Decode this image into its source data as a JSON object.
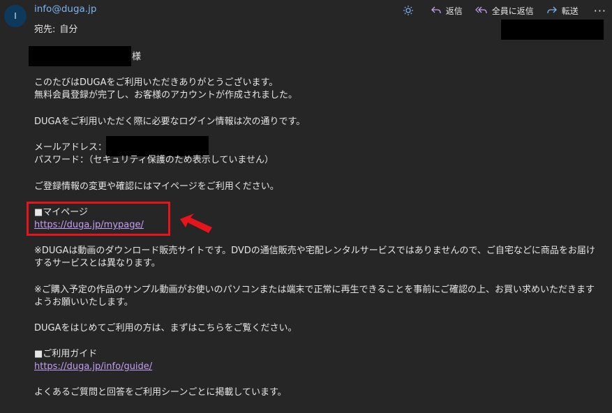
{
  "header": {
    "avatar_initial": "I",
    "sender": "info@duga.jp",
    "to_label": "宛先:",
    "to_value": "自分"
  },
  "toolbar": {
    "reply_label": "返信",
    "reply_all_label": "全員に返信",
    "forward_label": "転送",
    "more_label": "···"
  },
  "email": {
    "salutation_suffix": "様",
    "line_thanks": "このたびはDUGAをご利用いただきありがとうございます。",
    "line_registered": "無料会員登録が完了し、お客様のアカウントが作成されました。",
    "line_login_info": "DUGAをご利用いただく際に必要なログイン情報は次の通りです。",
    "email_label": "メールアドレス：",
    "password_line": "パスワード：（セキュリティ保護のため表示していません）",
    "line_mypage_info": "ご登録情報の変更や確認にはマイページをご利用ください。",
    "mypage_heading": "■マイページ",
    "mypage_url": "https://duga.jp/mypage/",
    "note_download": "※DUGAは動画のダウンロード販売サイトです。DVDの通信販売や宅配レンタルサービスではありませんので、ご自宅などに商品をお届けするサービスとは異なります。",
    "note_sample": "※ご購入予定の作品のサンプル動画がお使いのパソコンまたは端末で正常に再生できることを事前にご確認の上、お買い求めいただきますようお願いいたします。",
    "line_first_time": "DUGAをはじめてご利用の方は、まずはこちらをご覧ください。",
    "guide_heading": "■ご利用ガイド",
    "guide_url": "https://duga.jp/info/guide/",
    "line_faq": "よくあるご質問と回答をご利用シーンごとに掲載しています。"
  },
  "colors": {
    "background": "#262626",
    "link": "#c69ff5",
    "sender": "#7db3f0",
    "highlight": "#e8141b"
  }
}
